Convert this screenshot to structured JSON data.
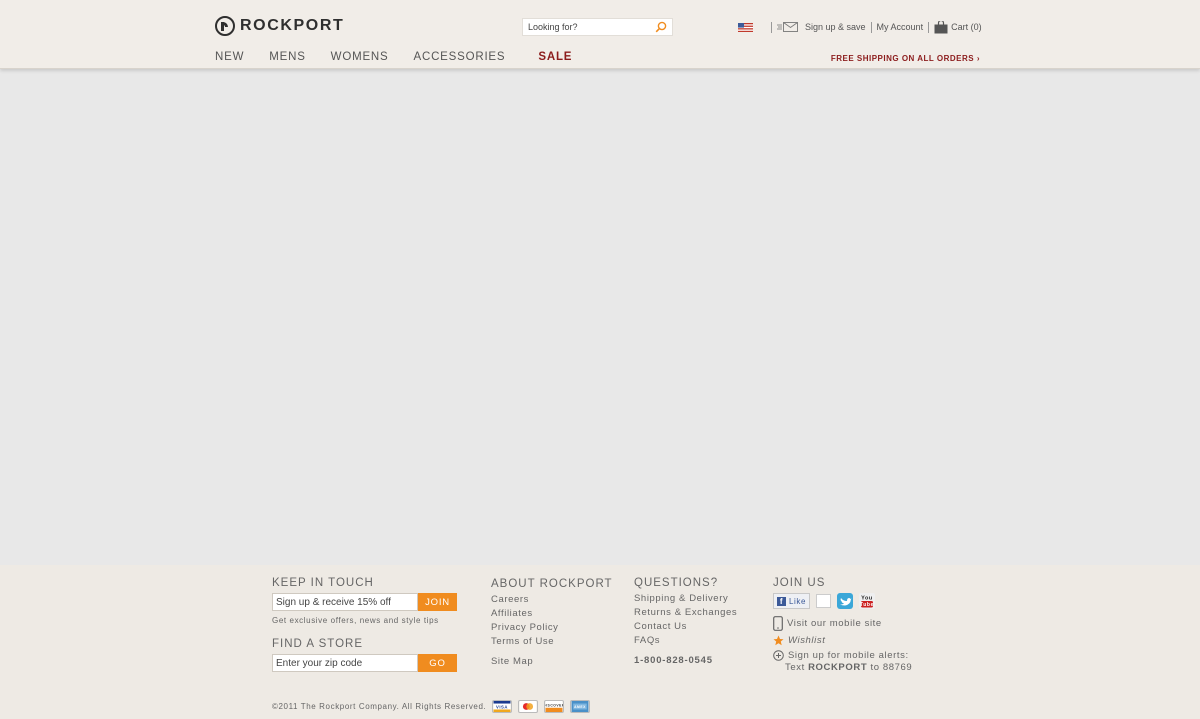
{
  "header": {
    "brand": "ROCKPORT",
    "search": {
      "placeholder": "Looking for?"
    },
    "links": {
      "signup": "Sign up & save",
      "account": "My Account",
      "cart": "Cart (0)"
    },
    "nav": [
      "NEW",
      "MENS",
      "WOMENS",
      "ACCESSORIES",
      "SALE"
    ],
    "free_shipping": "FREE SHIPPING ON ALL ORDERS ›"
  },
  "footer": {
    "keep_in_touch": {
      "heading": "KEEP IN TOUCH",
      "placeholder": "Sign up & receive 15% off",
      "button": "JOIN",
      "note": "Get exclusive offers, news and style tips"
    },
    "find_store": {
      "heading": "FIND A STORE",
      "placeholder": "Enter your zip code",
      "button": "GO"
    },
    "about": {
      "heading": "ABOUT ROCKPORT",
      "links": [
        "Careers",
        "Affiliates",
        "Privacy Policy",
        "Terms of Use",
        "Site Map"
      ]
    },
    "questions": {
      "heading": "QUESTIONS?",
      "links": [
        "Shipping & Delivery",
        "Returns & Exchanges",
        "Contact Us",
        "FAQs"
      ],
      "phone": "1-800-828-0545"
    },
    "join_us": {
      "heading": "JOIN US",
      "like": "Like",
      "mobile_site": "Visit our mobile site",
      "wishlist": "Wishlist",
      "alerts_1": "Sign up for mobile alerts:",
      "alerts_2a": "Text ",
      "alerts_2b": "ROCKPORT",
      "alerts_2c": " to 88769"
    },
    "copyright": "©2011 The Rockport Company. All Rights Reserved."
  },
  "colors": {
    "accent_orange": "#f08c1f",
    "sale_red": "#8c1c1c",
    "facebook_blue": "#3b5998",
    "twitter_blue": "#3aa7d8",
    "youtube_red": "#cc2222"
  }
}
